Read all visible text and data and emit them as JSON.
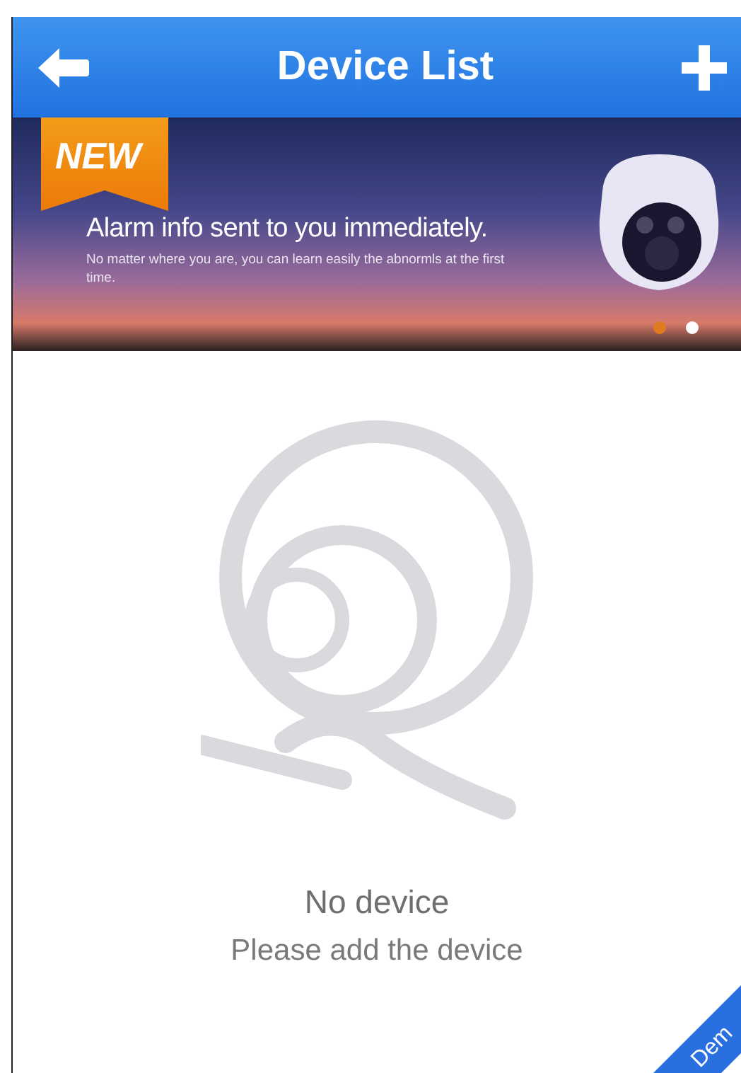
{
  "header": {
    "title": "Device List"
  },
  "banner": {
    "badge": "NEW",
    "headline": "Alarm info sent to you immediately.",
    "text": "No matter where you are, you can learn easily the abnormls at the first time.",
    "dots": [
      {
        "selected": false
      },
      {
        "selected": true
      }
    ]
  },
  "empty_state": {
    "title": "No device",
    "subtitle": "Please add the device"
  },
  "corner_ribbon": {
    "label": "Dem"
  }
}
